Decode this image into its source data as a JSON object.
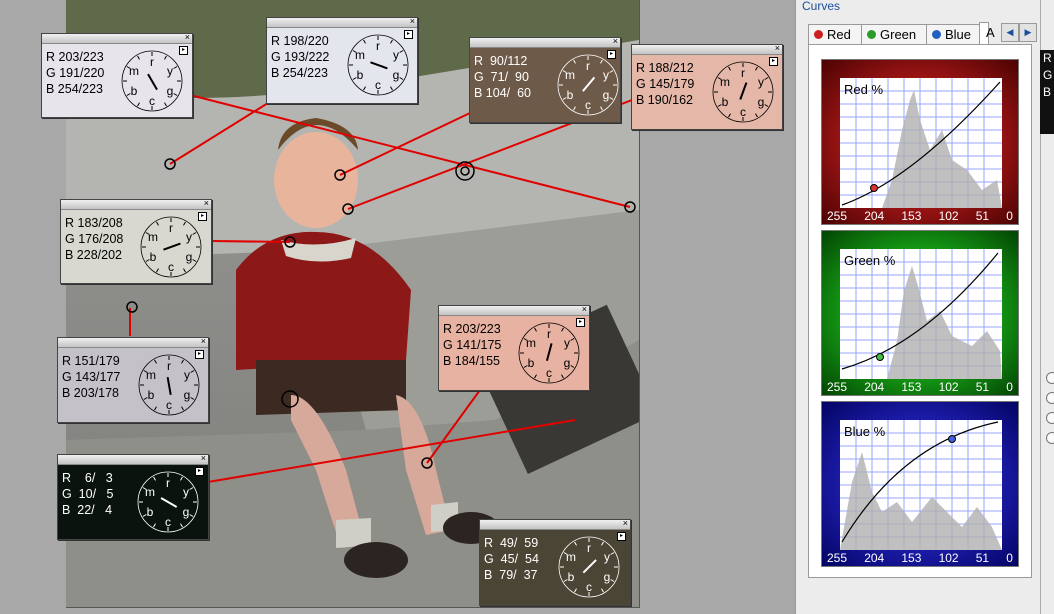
{
  "panel": {
    "title": "Curves",
    "tabs": [
      {
        "label": "Red",
        "dot_color": "#cc2020"
      },
      {
        "label": "Green",
        "dot_color": "#2a9a2a"
      },
      {
        "label": "Blue",
        "dot_color": "#2060c0"
      },
      {
        "label": "A",
        "dot_color": ""
      }
    ],
    "curves": [
      {
        "title": "Red %",
        "scale": [
          "255",
          "204",
          "153",
          "102",
          "51",
          "0"
        ],
        "bg": "#cf0000"
      },
      {
        "title": "Green %",
        "scale": [
          "255",
          "204",
          "153",
          "102",
          "51",
          "0"
        ],
        "bg": "#00b000"
      },
      {
        "title": "Blue %",
        "scale": [
          "255",
          "204",
          "153",
          "102",
          "51",
          "0"
        ],
        "bg": "#0000c0"
      }
    ],
    "mini_readout": [
      "R",
      "G",
      "B"
    ]
  },
  "probes": [
    {
      "r": "R 203/223",
      "g": "G 191/220",
      "b": "B 254/223",
      "bg": "#e8e4ec"
    },
    {
      "r": "R 198/220",
      "g": "G 193/222",
      "b": "B 254/223",
      "bg": "#e4e6ee"
    },
    {
      "r": "R  90/112",
      "g": "G  71/  90",
      "b": "B 104/  60",
      "bg": "#6e5a48"
    },
    {
      "r": "R 188/212",
      "g": "G 145/179",
      "b": "B 190/162",
      "bg": "#e5b7a8"
    },
    {
      "r": "R 183/208",
      "g": "G 176/208",
      "b": "B 228/202",
      "bg": "#d8d8d0"
    },
    {
      "r": "R 203/223",
      "g": "G 141/175",
      "b": "B 184/155",
      "bg": "#e8b2a2"
    },
    {
      "r": "R 151/179",
      "g": "G 143/177",
      "b": "B 203/178",
      "bg": "#c4c2c8"
    },
    {
      "r": "R    6/   3",
      "g": "G  10/   5",
      "b": "B  22/   4",
      "bg": "#0a130e"
    },
    {
      "r": "R  49/  59",
      "g": "G  45/  54",
      "b": "B  79/  37",
      "bg": "#4b4536"
    }
  ],
  "dial_letters": [
    "m",
    "r",
    "y",
    "g",
    "c",
    "b"
  ]
}
